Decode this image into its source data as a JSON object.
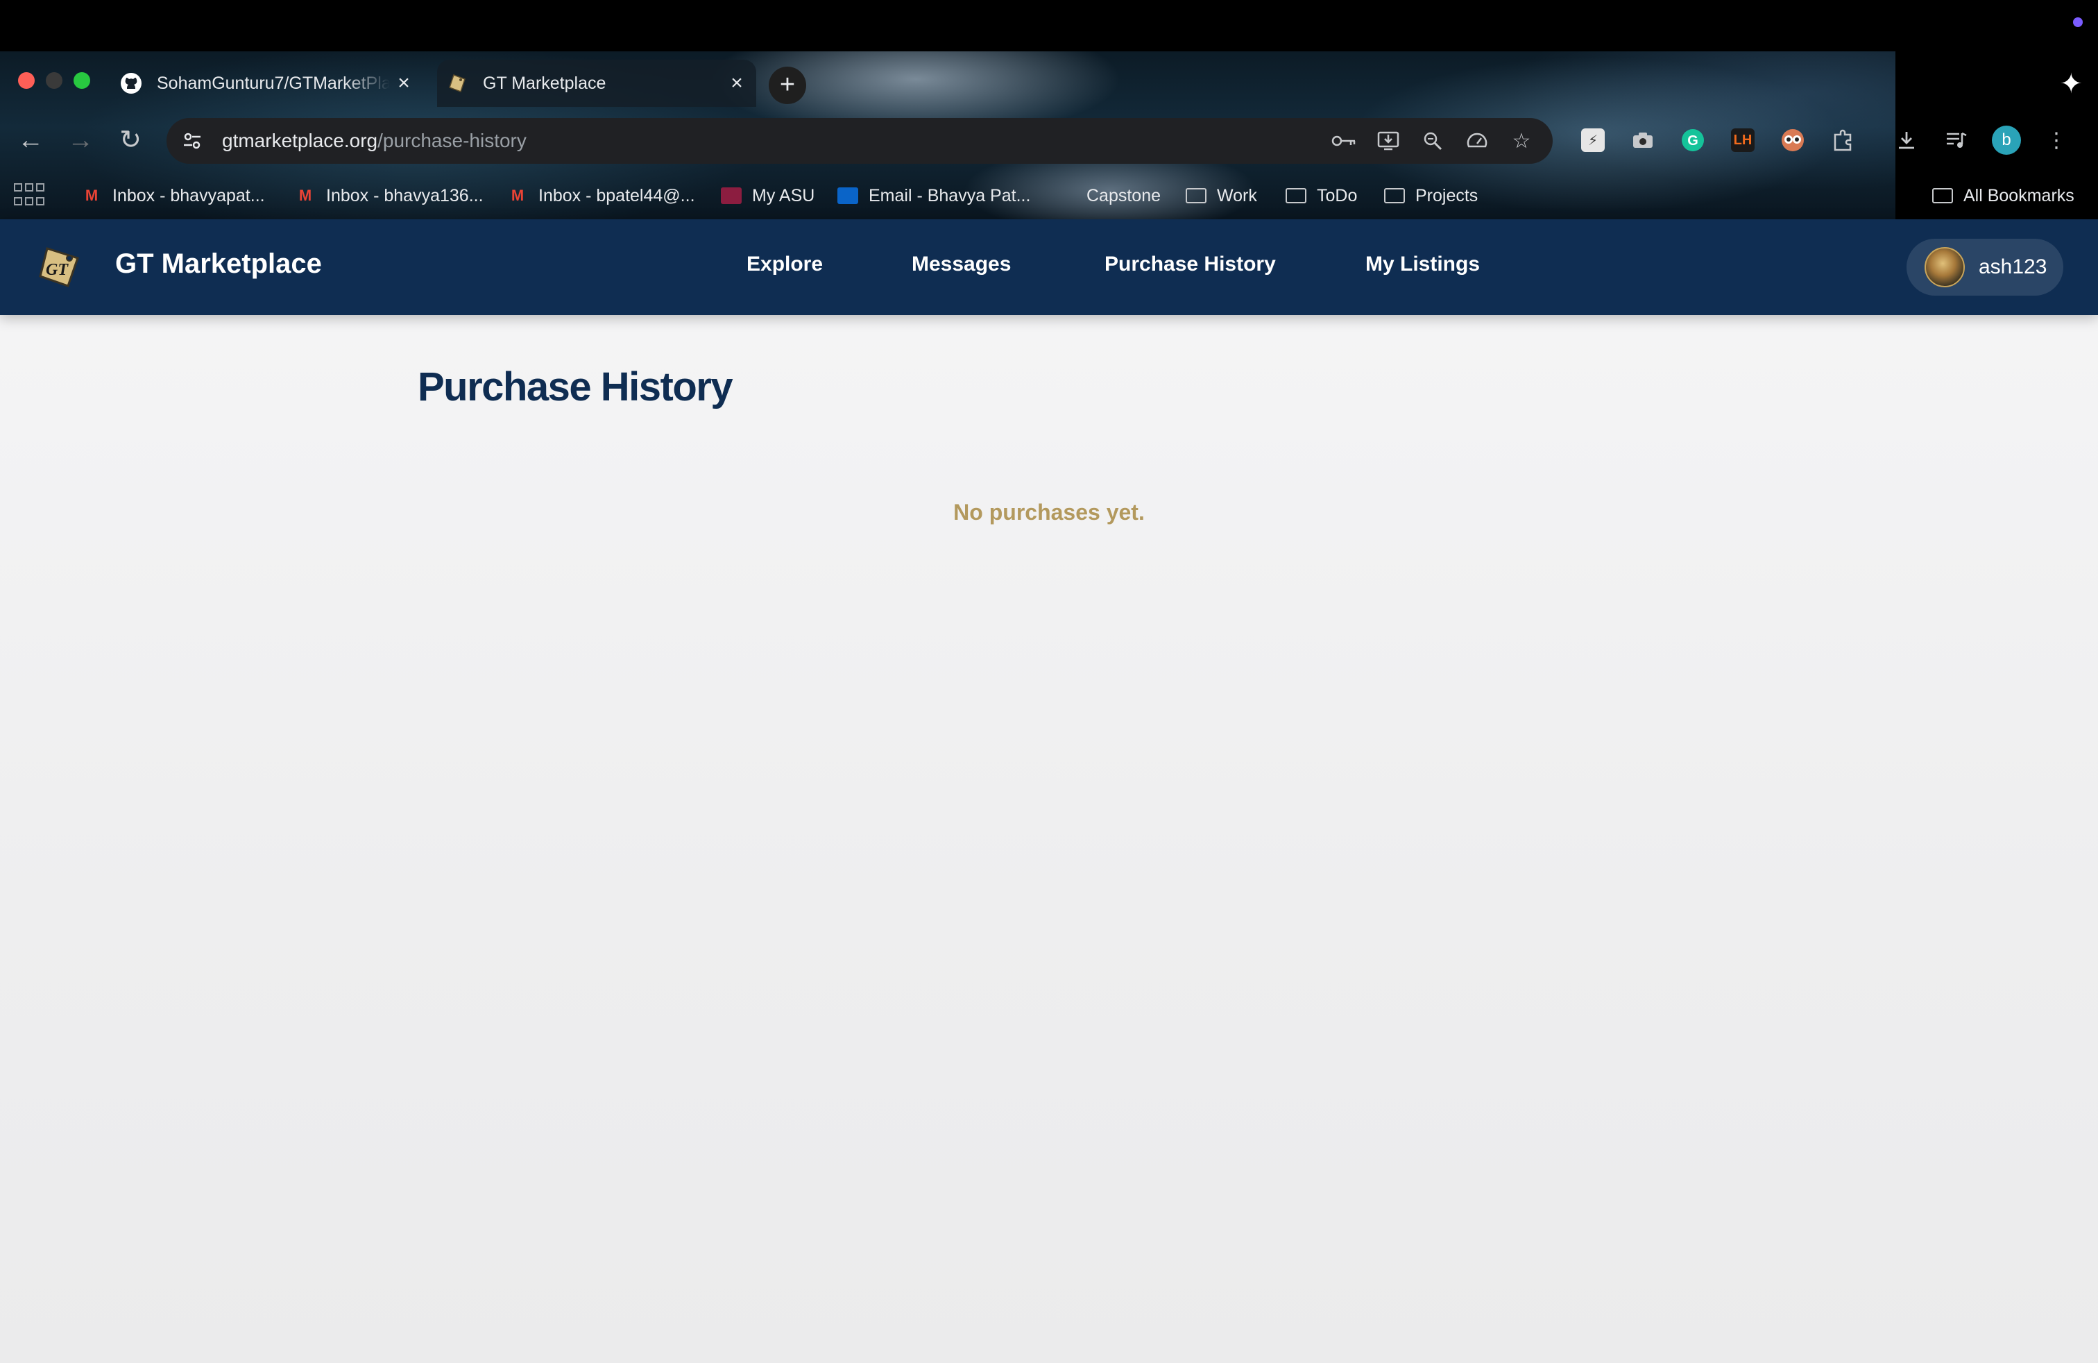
{
  "browser": {
    "tabs": [
      {
        "title": "SohamGunturu7/GTMarketPlace",
        "favicon": "github-icon"
      },
      {
        "title": "GT Marketplace",
        "favicon": "gt-marketplace-favicon"
      }
    ],
    "new_tab_label": "+",
    "url_domain": "gtmarketplace.org",
    "url_path": "/purchase-history",
    "bookmarks": [
      {
        "label": "Inbox - bhavyapat...",
        "icon": "gmail-icon"
      },
      {
        "label": "Inbox - bhavya136...",
        "icon": "gmail-icon"
      },
      {
        "label": "Inbox - bpatel44@...",
        "icon": "gmail-icon"
      },
      {
        "label": "My ASU",
        "icon": "asu-icon"
      },
      {
        "label": "Email - Bhavya Pat...",
        "icon": "outlook-icon"
      },
      {
        "label": "Capstone",
        "icon": "page-icon"
      },
      {
        "label": "Work",
        "icon": "folder-icon"
      },
      {
        "label": "ToDo",
        "icon": "folder-icon"
      },
      {
        "label": "Projects",
        "icon": "folder-icon"
      }
    ],
    "all_bookmarks_label": "All Bookmarks",
    "profile_initial": "b",
    "extension_labels": {
      "lh": "LH"
    }
  },
  "app": {
    "brand": "GT Marketplace",
    "brand_color": "#0f2d52",
    "accent_color": "#b3995d",
    "nav": {
      "explore": "Explore",
      "messages": "Messages",
      "purchase_history": "Purchase History",
      "my_listings": "My Listings"
    },
    "user": {
      "username": "ash123"
    }
  },
  "main": {
    "title": "Purchase History",
    "empty_message": "No purchases yet."
  }
}
